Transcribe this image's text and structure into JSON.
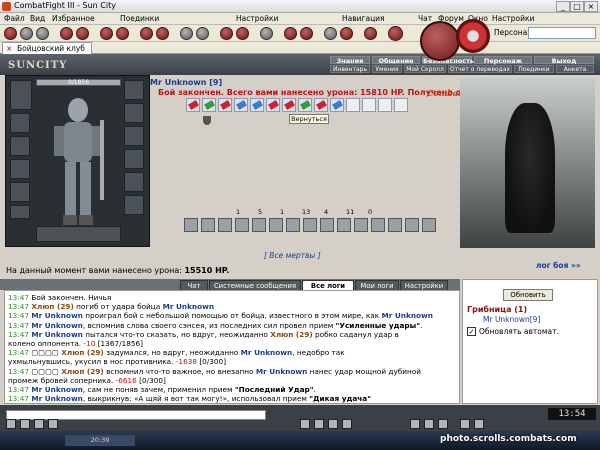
{
  "window": {
    "title": "CombatFight III - Sun City"
  },
  "menu": [
    "Файл",
    "Вид",
    "Избранное",
    "Поединки",
    "Настройки",
    "Навигация",
    "Чат",
    "Форум",
    "Окно",
    "Настройки"
  ],
  "toolbar": {
    "persona_label": "Персонаж:"
  },
  "tabs": [
    {
      "label": "Бойцовский клуб"
    }
  ],
  "game": {
    "logo": "SUNCITY",
    "nav_top": [
      "Знания",
      "Общение",
      "Безопасность",
      "Персонаж",
      "Выход"
    ],
    "nav_sub": [
      "Инвентарь",
      "Умения",
      "Мой Скролл",
      "Отчет о переводах",
      "Поединки",
      "Анкета"
    ]
  },
  "character": {
    "hp_text": "0/1856",
    "hp_fraction": 0.0
  },
  "battle": {
    "opponent_name": "Mr Unknown [9]",
    "message": "Бой закончен. Всего вами нанесено урона: 15810 HP. Получено опыта:",
    "site_title": "Combats.Ru (БК)",
    "return_button": "Вернуться",
    "stats": [
      "1",
      "5",
      "1",
      "13",
      "4",
      "11",
      "0"
    ],
    "deaths_link": "[ Все мертвы ]",
    "log_link": "лог боя »»",
    "damage_label": "На данный момент вами нанесено урона:",
    "damage_value": "15510 HP."
  },
  "chat": {
    "tabs": [
      "Чат",
      "Системные сообщения",
      "Все логи",
      "Мои логи",
      "Настройки"
    ],
    "active_tab": "Все логи",
    "lines": [
      [
        {
          "t": "13:47 ",
          "c": "tm"
        },
        {
          "t": "Бой закончен. Ничья",
          "c": ""
        }
      ],
      [
        {
          "t": "13:47 ",
          "c": "tm"
        },
        {
          "t": "Хлюп (29)",
          "c": "nm2"
        },
        {
          "t": " погиб от удара бойца ",
          "c": ""
        },
        {
          "t": "Mr Unknown",
          "c": "nm"
        }
      ],
      [
        {
          "t": "13:47 ",
          "c": "tm"
        },
        {
          "t": "Mr Unknown",
          "c": "nm"
        },
        {
          "t": " проиграл бой с небольшой помощью от бойца, известного в этом мире, как ",
          "c": ""
        },
        {
          "t": "Mr Unknown",
          "c": "nm"
        }
      ],
      [
        {
          "t": "13:47 ",
          "c": "tm"
        },
        {
          "t": "Mr Unknown",
          "c": "nm"
        },
        {
          "t": ", вспомнив слова своего сэнсея, из последних сил провел прием ",
          "c": ""
        },
        {
          "t": "\"Усиленные удары\"",
          "c": "bold"
        },
        {
          "t": ".",
          "c": ""
        }
      ],
      [
        {
          "t": "13:47 ",
          "c": "tm"
        },
        {
          "t": "Mr Unknown",
          "c": "nm"
        },
        {
          "t": " пытался что-то сказать, но вдруг, неожиданно ",
          "c": ""
        },
        {
          "t": "Хлюп (29)",
          "c": "nm2"
        },
        {
          "t": " робко саданул удар в",
          "c": ""
        }
      ],
      [
        {
          "t": "колено оппонента. ",
          "c": ""
        },
        {
          "t": "-10",
          "c": "red"
        },
        {
          "t": " [1367/1856]",
          "c": ""
        }
      ],
      [
        {
          "t": "13:47 ",
          "c": "tm"
        },
        {
          "t": "▢▢▢▢ ",
          "c": ""
        },
        {
          "t": "Хлюп (29)",
          "c": "nm2"
        },
        {
          "t": " задумался, но вдруг, неожиданно ",
          "c": ""
        },
        {
          "t": "Mr Unknown",
          "c": "nm"
        },
        {
          "t": ", недобро так",
          "c": ""
        }
      ],
      [
        {
          "t": "ухмыльнувшись, укусил в нос противника. ",
          "c": ""
        },
        {
          "t": "-1638",
          "c": "red"
        },
        {
          "t": " [0/300]",
          "c": ""
        }
      ],
      [
        {
          "t": "13:47 ",
          "c": "tm"
        },
        {
          "t": "▢▢▢▢ ",
          "c": ""
        },
        {
          "t": "Хлюп (29)",
          "c": "nm2"
        },
        {
          "t": " вспомнил что-то важное, но внезапно ",
          "c": ""
        },
        {
          "t": "Mr Unknown",
          "c": "nm"
        },
        {
          "t": " нанес удар мощной дубиной",
          "c": ""
        }
      ],
      [
        {
          "t": "промеж бровей соперника. ",
          "c": ""
        },
        {
          "t": "-6616",
          "c": "red"
        },
        {
          "t": " [0/300]",
          "c": ""
        }
      ],
      [
        {
          "t": "13:47 ",
          "c": "tm"
        },
        {
          "t": "Mr Unknown",
          "c": "nm"
        },
        {
          "t": ", сам не поняв зачем, применил прием ",
          "c": ""
        },
        {
          "t": "\"Последний Удар\"",
          "c": "bold"
        },
        {
          "t": ".",
          "c": ""
        }
      ],
      [
        {
          "t": "13:47 ",
          "c": "tm"
        },
        {
          "t": "Mr Unknown",
          "c": "nm"
        },
        {
          "t": ", выкрикнув: «А щяй я вот так могу!», использовал прием ",
          "c": ""
        },
        {
          "t": "\"Дикая удача\"",
          "c": "bold"
        }
      ]
    ]
  },
  "right_panel": {
    "refresh_button": "Обновить",
    "location": "Грибница (1)",
    "user": "Mr Unknown[9]",
    "auto_checkbox_checked": true,
    "auto_label": "Обновлять автомат."
  },
  "status": {
    "clock": "13:54",
    "task_time": "20:39"
  },
  "watermark": "photo.scrolls.combats.com"
}
